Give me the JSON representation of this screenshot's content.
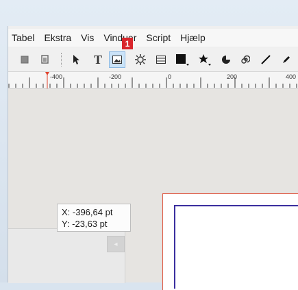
{
  "menu": {
    "items": [
      "Tabel",
      "Ekstra",
      "Vis",
      "Vinduer",
      "Script",
      "Hjælp"
    ]
  },
  "toolbar": {
    "tools": [
      {
        "icon": "grid-square-icon"
      },
      {
        "icon": "copy-square-icon"
      },
      {
        "icon": "pointer-arrow-icon"
      },
      {
        "icon": "text-frame-icon",
        "label": "T"
      },
      {
        "icon": "image-frame-icon",
        "active": true
      },
      {
        "icon": "render-frame-icon"
      },
      {
        "icon": "table-icon"
      },
      {
        "icon": "shape-rectangle-icon"
      },
      {
        "icon": "star-polygon-icon"
      },
      {
        "icon": "arc-icon"
      },
      {
        "icon": "spiral-icon"
      },
      {
        "icon": "line-icon"
      },
      {
        "icon": "pen-icon"
      }
    ],
    "badge": "1"
  },
  "ruler": {
    "labels": [
      "-400",
      "-200",
      "0",
      "200",
      "400"
    ],
    "marker_color": "#e0412b"
  },
  "tooltip": {
    "x": "X: -396,64 pt",
    "y": "Y: -23,63 pt"
  },
  "colors": {
    "bleed_line": "#e05a44",
    "margin_line": "#3a2e9e",
    "badge": "#d9262c"
  }
}
